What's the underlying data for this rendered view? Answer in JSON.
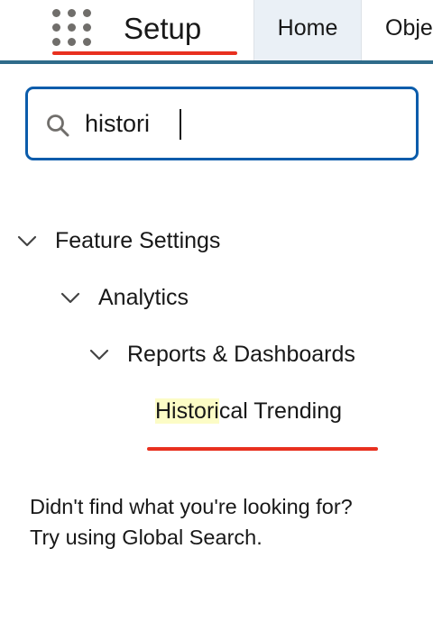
{
  "header": {
    "app_launcher_icon": "app-launcher-grid-icon",
    "title": "Setup",
    "tabs": [
      {
        "label": "Home",
        "selected": true
      },
      {
        "label": "Obje",
        "selected": false
      }
    ]
  },
  "search": {
    "icon": "search-icon",
    "value": "histori",
    "placeholder": ""
  },
  "tree": {
    "level1": {
      "label": "Feature Settings",
      "expanded": true
    },
    "level2": {
      "label": "Analytics",
      "expanded": true
    },
    "level3": {
      "label": "Reports & Dashboards",
      "expanded": true
    },
    "result": {
      "match": "Histori",
      "rest": "cal Trending"
    }
  },
  "footer": {
    "line1": "Didn't find what you're looking for?",
    "line2": "Try using Global Search."
  },
  "colors": {
    "brand_bar": "#2e6b8a",
    "focus_border": "#0b5cab",
    "annotation_red": "#e8301f",
    "highlight": "#fcfcc6",
    "active_tab_bg": "#eaf0f6"
  }
}
